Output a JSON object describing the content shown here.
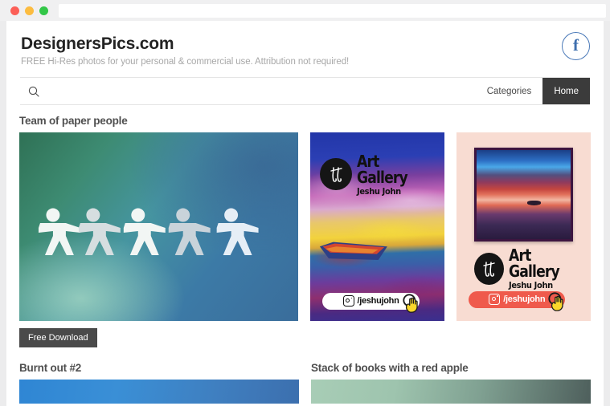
{
  "window": {
    "traffic_lights": [
      "close",
      "minimize",
      "maximize"
    ],
    "address_bar_value": "",
    "colors": {
      "close": "#fc5f57",
      "minimize": "#fcbc40",
      "maximize": "#33c748"
    }
  },
  "header": {
    "brand": "DesignersPics.com",
    "tagline": "FREE Hi-Res photos for your personal & commercial use. Attribution not required!",
    "facebook_icon": "facebook-icon",
    "facebook_letter": "f",
    "facebook_color": "#3f6fae"
  },
  "navbar": {
    "search_icon": "search-icon",
    "search_value": "",
    "search_placeholder": "",
    "links": [
      {
        "label": "Categories",
        "active": false
      },
      {
        "label": "Home",
        "active": true
      }
    ],
    "active_bg": "#3b3b3b"
  },
  "gallery": {
    "row1": {
      "caption": "Team of paper people",
      "photo": {
        "alt": "Team of paper people",
        "download_label": "Free Download"
      },
      "ads": [
        {
          "name": "art-gallery-ad-painting",
          "title": "Art Gallery",
          "subtitle": "Jeshu John",
          "handle": "/jeshujohn",
          "instagram_icon": "instagram-icon",
          "cursor_icon": "hand-cursor-icon",
          "pill_style": "light",
          "pill_bg": "#ffffff",
          "pill_text_color": "#111111"
        },
        {
          "name": "art-gallery-ad-framed",
          "title": "Art Gallery",
          "subtitle": "Jeshu John",
          "handle": "/jeshujohn",
          "instagram_icon": "instagram-icon",
          "cursor_icon": "hand-cursor-icon",
          "pill_style": "coral",
          "pill_bg": "#ef5a4c",
          "pill_text_color": "#ffffff",
          "background": "#f8dcd2"
        }
      ]
    },
    "row2": [
      {
        "caption": "Burnt out #2",
        "alt": "Burnt out #2"
      },
      {
        "caption": "Stack of books with a red apple",
        "alt": "Stack of books with a red apple"
      }
    ]
  },
  "download_button": {
    "label": "Free Download",
    "bg": "#4a4a4a"
  }
}
